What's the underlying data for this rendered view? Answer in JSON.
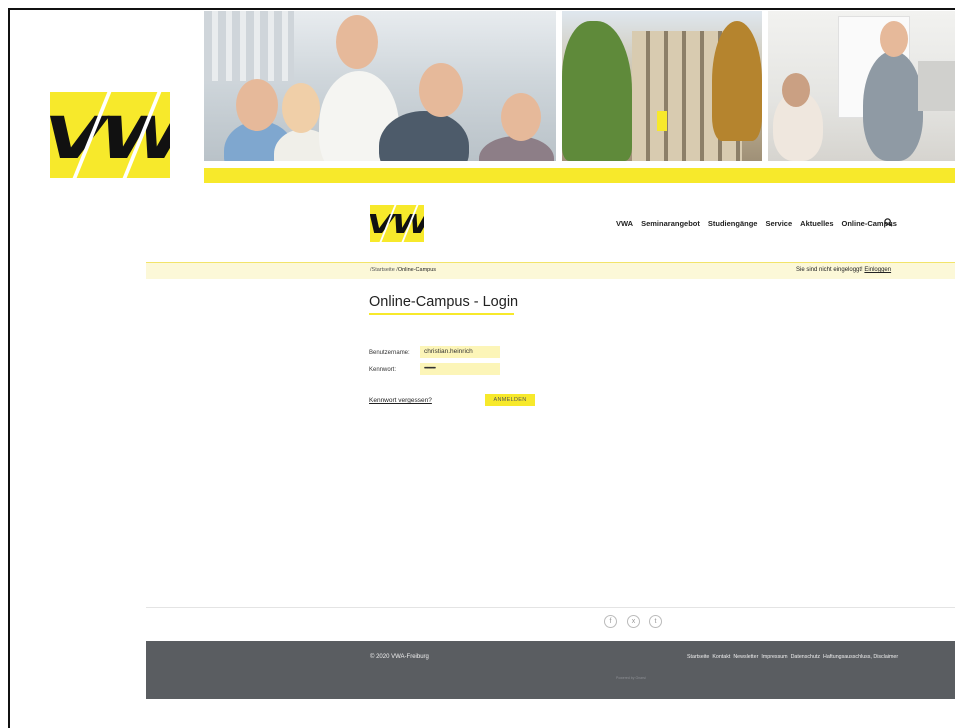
{
  "brand": {
    "logo_text": "VWA",
    "accent": "#f7e92b"
  },
  "nav": {
    "items": [
      "VWA",
      "Seminarangebot",
      "Studiengänge",
      "Service",
      "Aktuelles",
      "Online-Campus"
    ],
    "search_icon": "search-icon"
  },
  "breadcrumb": {
    "items": [
      "Startseite",
      "Online-Campus"
    ]
  },
  "login_status": {
    "text": "Sie sind nicht eingeloggt!",
    "link": "Einloggen"
  },
  "page": {
    "title": "Online-Campus - Login"
  },
  "form": {
    "username_label": "Benutzername:",
    "username_value": "christian.heinrich",
    "password_label": "Kennwort:",
    "password_value": "••••••••••",
    "forgot_link": "Kennwort vergessen?",
    "submit_label": "ANMELDEN"
  },
  "social": {
    "icons": [
      "f",
      "x",
      "t"
    ],
    "names": [
      "facebook-icon",
      "xing-icon",
      "twitter-icon"
    ]
  },
  "footer": {
    "copyright": "© 2020 VWA-Freiburg",
    "links": [
      "Startseite",
      "Kontakt",
      "Newsletter",
      "Impressum",
      "Datenschutz",
      "Haftungsausschluss, Disclaimer"
    ],
    "powered": "Powered by Gnarsi"
  }
}
